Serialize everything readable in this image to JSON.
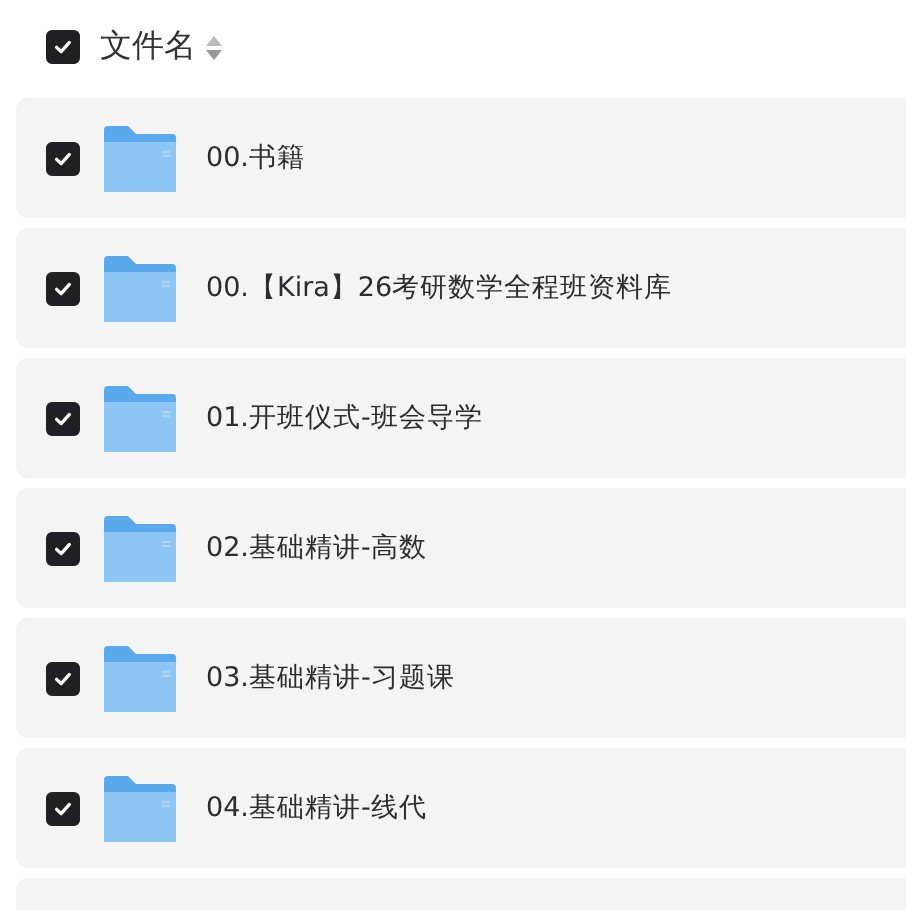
{
  "header": {
    "checked": true,
    "label": "文件名"
  },
  "files": [
    {
      "name": "00.书籍",
      "checked": true
    },
    {
      "name": "00.【Kira】26考研数学全程班资料库",
      "checked": true
    },
    {
      "name": "01.开班仪式-班会导学",
      "checked": true
    },
    {
      "name": "02.基础精讲-高数",
      "checked": true
    },
    {
      "name": "03.基础精讲-习题课",
      "checked": true
    },
    {
      "name": "04.基础精讲-线代",
      "checked": true
    }
  ]
}
